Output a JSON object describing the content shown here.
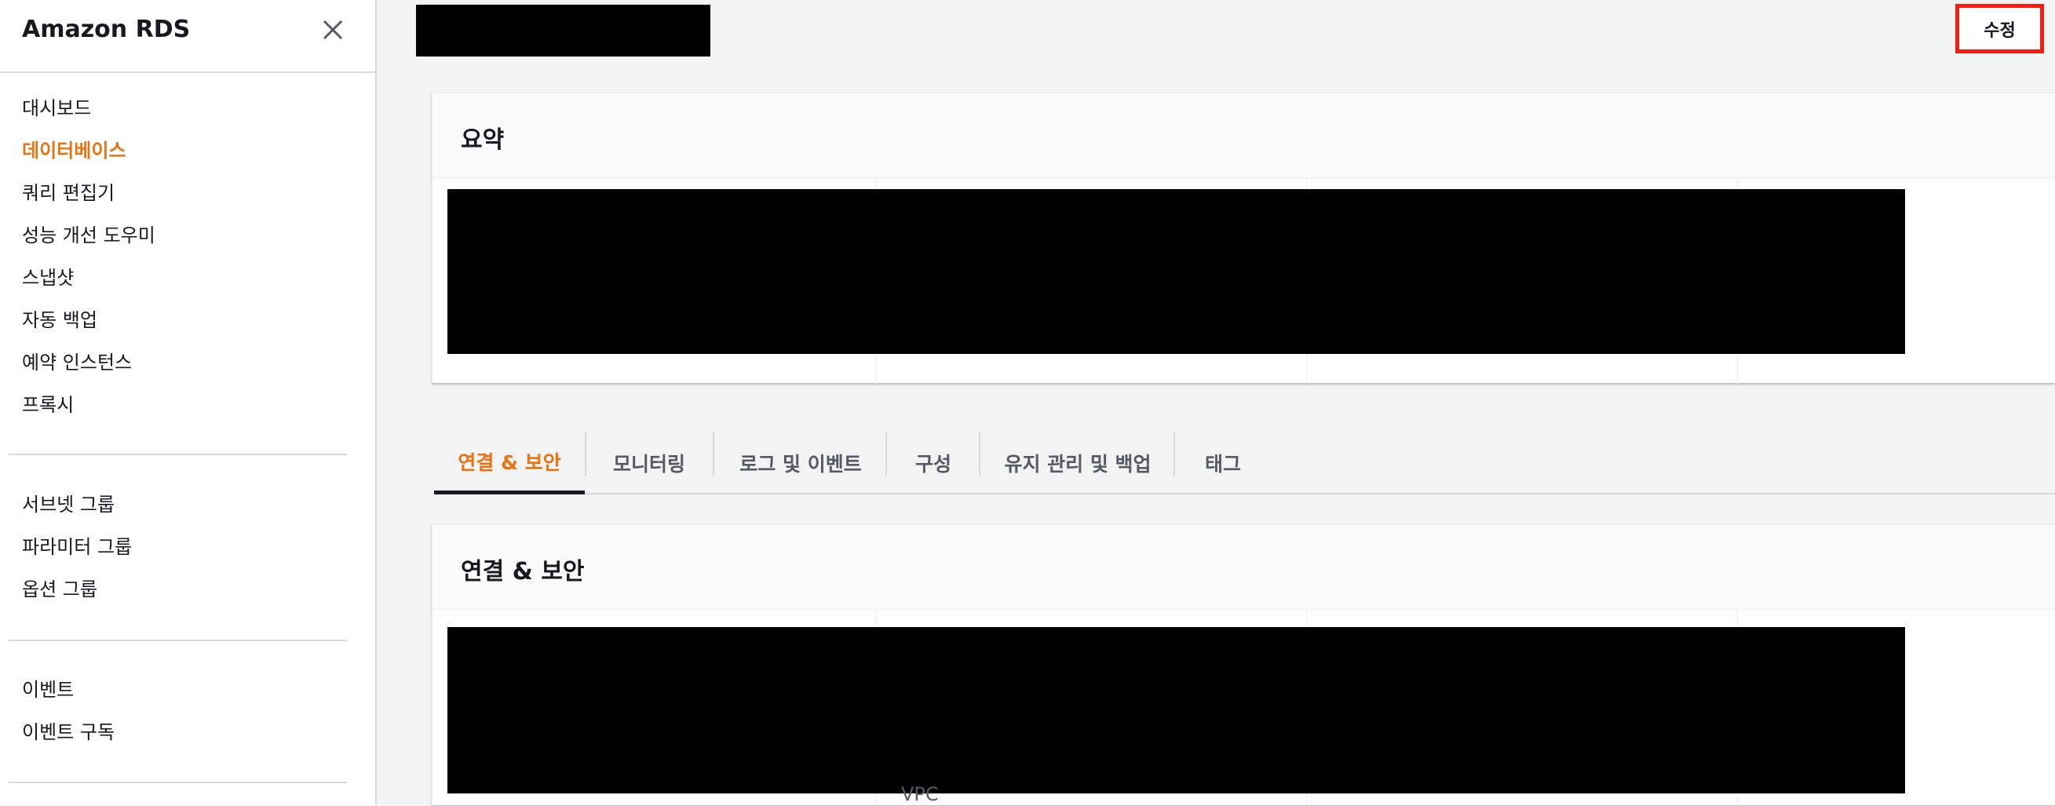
{
  "sidebar": {
    "title": "Amazon RDS",
    "close_icon": "close-icon",
    "groups": [
      {
        "items": [
          {
            "label": "대시보드",
            "active": false
          },
          {
            "label": "데이터베이스",
            "active": true
          },
          {
            "label": "쿼리 편집기",
            "active": false
          },
          {
            "label": "성능 개선 도우미",
            "active": false
          },
          {
            "label": "스냅샷",
            "active": false
          },
          {
            "label": "자동 백업",
            "active": false
          },
          {
            "label": "예약 인스턴스",
            "active": false
          },
          {
            "label": "프록시",
            "active": false
          }
        ]
      },
      {
        "items": [
          {
            "label": "서브넷 그룹",
            "active": false
          },
          {
            "label": "파라미터 그룹",
            "active": false
          },
          {
            "label": "옵션 그룹",
            "active": false
          }
        ]
      },
      {
        "items": [
          {
            "label": "이벤트",
            "active": false
          },
          {
            "label": "이벤트 구독",
            "active": false
          }
        ]
      }
    ]
  },
  "header": {
    "edit_label": "수정"
  },
  "summary": {
    "title": "요약"
  },
  "tabs": [
    {
      "label": "연결 & 보안",
      "active": true
    },
    {
      "label": "모니터링",
      "active": false
    },
    {
      "label": "로그 및 이벤트",
      "active": false
    },
    {
      "label": "구성",
      "active": false
    },
    {
      "label": "유지 관리 및 백업",
      "active": false
    },
    {
      "label": "태그",
      "active": false
    }
  ],
  "connectivity": {
    "title": "연결 & 보안",
    "vpc_label": "VPC"
  },
  "colors": {
    "accent": "#ec7211",
    "highlight_border": "#ff1a0d",
    "redaction": "#000000"
  }
}
